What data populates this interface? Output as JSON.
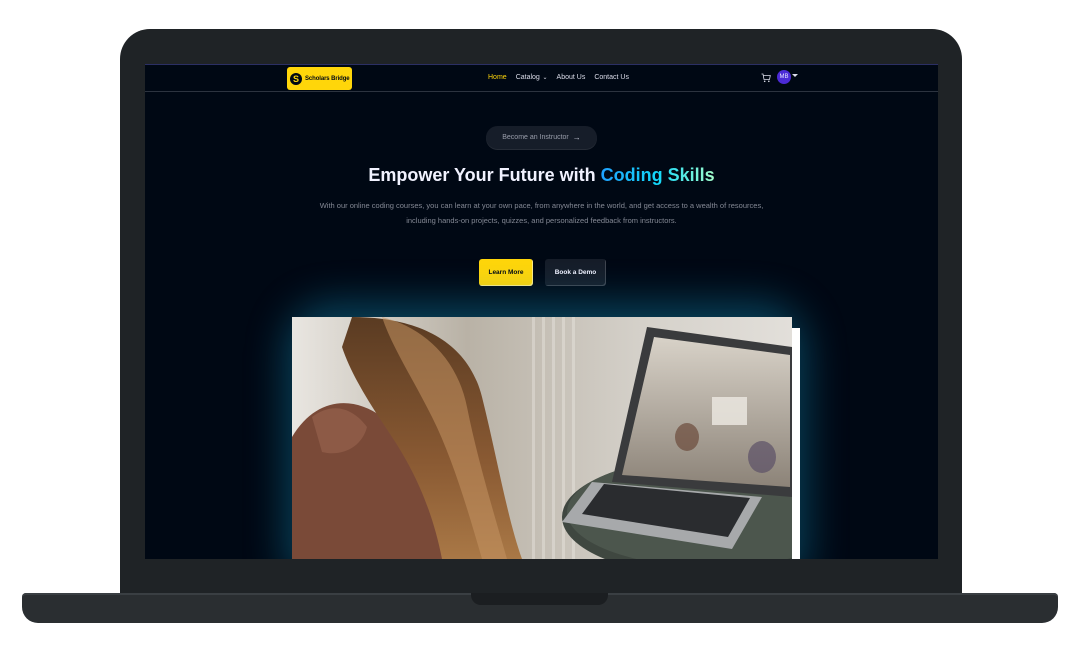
{
  "navbar": {
    "logo_text": "Scholars Bridge",
    "links": [
      {
        "label": "Home",
        "active": true
      },
      {
        "label": "Catalog",
        "active": false
      },
      {
        "label": "About Us",
        "active": false
      },
      {
        "label": "Contact Us",
        "active": false
      }
    ],
    "cart_icon": "cart-icon",
    "avatar_initials": "MB"
  },
  "hero": {
    "instructor_label": "Become an Instructor",
    "title_prefix": "Empower Your Future with ",
    "title_highlight": "Coding Skills",
    "description": "With our online coding courses, you can learn at your own pace, from anywhere in the world, and get access to a wealth of resources, including hands-on projects, quizzes, and personalized feedback from instructors.",
    "learn_more_label": "Learn More",
    "book_demo_label": "Book a Demo"
  },
  "colors": {
    "background": "#000814",
    "accent": "#ffd60a",
    "highlight_gradient": [
      "#1fa2ff",
      "#12d8fa",
      "#a6ffcb"
    ],
    "avatar": "#4b2ad6"
  }
}
